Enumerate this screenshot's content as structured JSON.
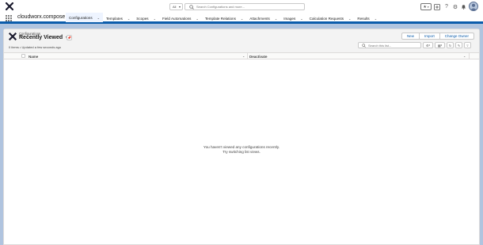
{
  "header": {
    "search_scope": "All",
    "search_placeholder": "Search Configurations and more...",
    "avatar_initials": "PU"
  },
  "nav": {
    "app_name": "cloudworx.compose",
    "items": [
      {
        "label": "Configurations",
        "active": true
      },
      {
        "label": "Templates"
      },
      {
        "label": "Scopes"
      },
      {
        "label": "Field Automations"
      },
      {
        "label": "Template Relations"
      },
      {
        "label": "Attachments"
      },
      {
        "label": "Images"
      },
      {
        "label": "Calculation Requests"
      },
      {
        "label": "Results"
      }
    ]
  },
  "list": {
    "breadcrumb": "Configurations",
    "title": "Recently Viewed",
    "status": "0 items • Updated a few seconds ago",
    "buttons": {
      "new": "New",
      "import": "Import",
      "change_owner": "Change Owner"
    },
    "search_placeholder": "Search this list..."
  },
  "table": {
    "columns": [
      "Name",
      "Deactivate"
    ]
  },
  "empty_state": {
    "line1": "You haven't viewed any configurations recently.",
    "line2": "Try switching list views."
  },
  "colors": {
    "brand": "#0b5cab",
    "background": "#b0c4df",
    "logo": "#1a1a2e"
  }
}
